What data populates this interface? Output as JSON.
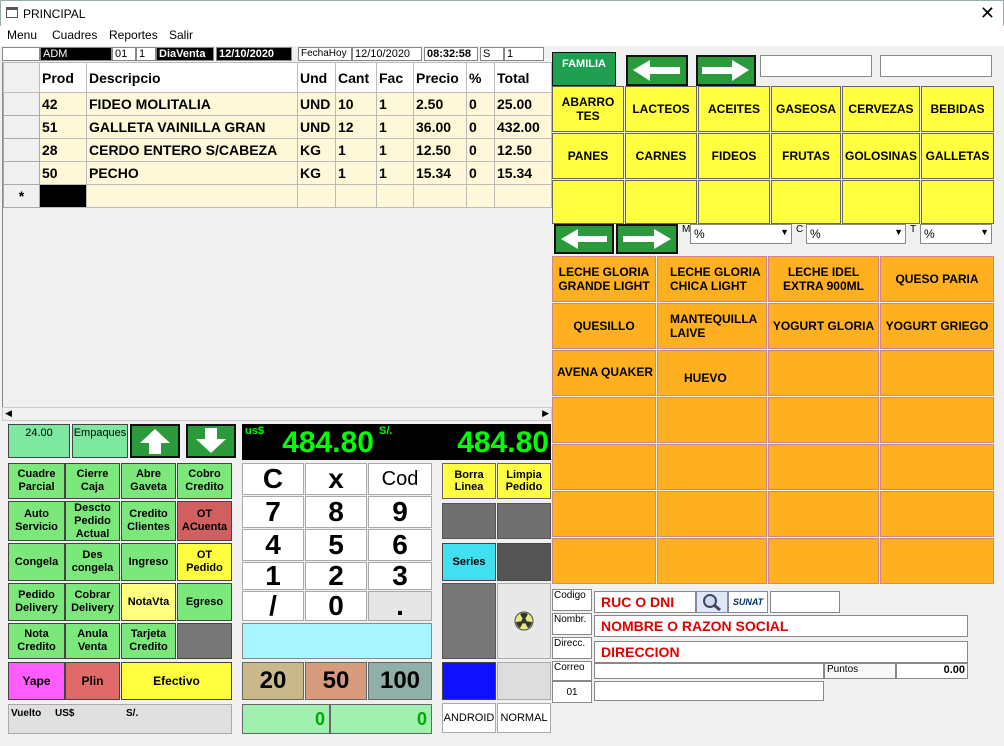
{
  "window": {
    "title": "PRINCIPAL",
    "close": "✕"
  },
  "menu": [
    "Menu",
    "Cuadres",
    "Reportes",
    "Salir"
  ],
  "info": {
    "user": "ADM",
    "f1": "01",
    "f2": "1",
    "dia_label": "DiaVenta",
    "dia_date": "12/10/2020",
    "fecha_label": "FechaHoy",
    "fecha": "12/10/2020",
    "time": "08:32:58",
    "s": "S",
    "s_val": "1"
  },
  "grid": {
    "headers": [
      "Prod",
      "Descripcio",
      "Und",
      "Cant",
      "Fac",
      "Precio",
      "%",
      "Total"
    ],
    "rows": [
      [
        "42",
        "FIDEO MOLITALIA",
        "UND",
        "10",
        "1",
        "2.50",
        "0",
        "25.00"
      ],
      [
        "51",
        "GALLETA VAINILLA GRAN",
        "UND",
        "12",
        "1",
        "36.00",
        "0",
        "432.00"
      ],
      [
        "28",
        "CERDO ENTERO S/CABEZA",
        "KG",
        "1",
        "1",
        "12.50",
        "0",
        "12.50"
      ],
      [
        "50",
        "PECHO",
        "KG",
        "1",
        "1",
        "15.34",
        "0",
        "15.34"
      ]
    ],
    "new_row_marker": "*"
  },
  "stock": {
    "value": "24.00",
    "empaques": "Empaques"
  },
  "totals": {
    "usd_label": "us$",
    "usd": "484.80",
    "pen_label": "S/.",
    "pen": "484.80"
  },
  "left_buttons": [
    [
      "Cuadre Parcial",
      "Cierre Caja",
      "Abre Gaveta",
      "Cobro Credito"
    ],
    [
      "Auto Servicio",
      "Descto Pedido Actual",
      "Credito Clientes",
      "OT ACuenta"
    ],
    [
      "Congela",
      "Des congela",
      "Ingreso",
      "OT Pedido"
    ],
    [
      "Pedido Delivery",
      "Cobrar Delivery",
      "NotaVta",
      "Egreso"
    ],
    [
      "Nota Credito",
      "Anula Venta",
      "Tarjeta Credito",
      ""
    ]
  ],
  "pay": {
    "yape": "Yape",
    "plin": "Plin",
    "efectivo": "Efectivo"
  },
  "vuelto": {
    "label": "Vuelto",
    "usd": "US$",
    "pen": "S/."
  },
  "keypad": [
    "C",
    "x",
    "Cod",
    "7",
    "8",
    "9",
    "4",
    "5",
    "6",
    "1",
    "2",
    "3",
    "/",
    "0",
    "."
  ],
  "bills": [
    "20",
    "50",
    "100"
  ],
  "change": [
    "0",
    "0"
  ],
  "side": {
    "borra": "Borra Linea",
    "limpia": "Limpia Pedido",
    "series": "Series",
    "android": "ANDROID",
    "normal": "NORMAL"
  },
  "familia": {
    "label": "FAMILIA"
  },
  "categories": [
    [
      "ABARRO TES",
      "LACTEOS",
      "ACEITES",
      "GASEOSA",
      "CERVEZAS",
      "BEBIDAS"
    ],
    [
      "PANES",
      "CARNES",
      "FIDEOS",
      "FRUTAS",
      "GOLOSINAS",
      "GALLETAS"
    ],
    [
      "",
      "",
      "",
      "",
      "",
      ""
    ]
  ],
  "filters": {
    "m": "M",
    "c": "C",
    "t": "T",
    "val": "%"
  },
  "products": [
    [
      "LECHE GLORIA GRANDE LIGHT",
      "LECHE GLORIA CHICA LIGHT",
      "LECHE IDEL EXTRA 900ML",
      "QUESO PARIA"
    ],
    [
      "QUESILLO",
      "MANTEQUILLA LAIVE",
      "YOGURT GLORIA",
      "YOGURT GRIEGO"
    ],
    [
      "AVENA QUAKER",
      "HUEVO",
      "",
      ""
    ]
  ],
  "client": {
    "codigo": "Codigo",
    "ruc": "RUC O DNI",
    "sunat": "SUNAT",
    "nombre_lbl": "Nombr.",
    "nombre": "NOMBRE O RAZON SOCIAL",
    "direc_lbl": "Direcc.",
    "direc": "DIRECCION",
    "correo_lbl": "Correo",
    "correo_val": "01",
    "puntos": "Puntos",
    "puntos_val": "0.00"
  },
  "colors": {
    "green": "#7ce87c",
    "yellow": "#ffff40",
    "orange": "#ffb020",
    "lcd": "#00ff00"
  }
}
